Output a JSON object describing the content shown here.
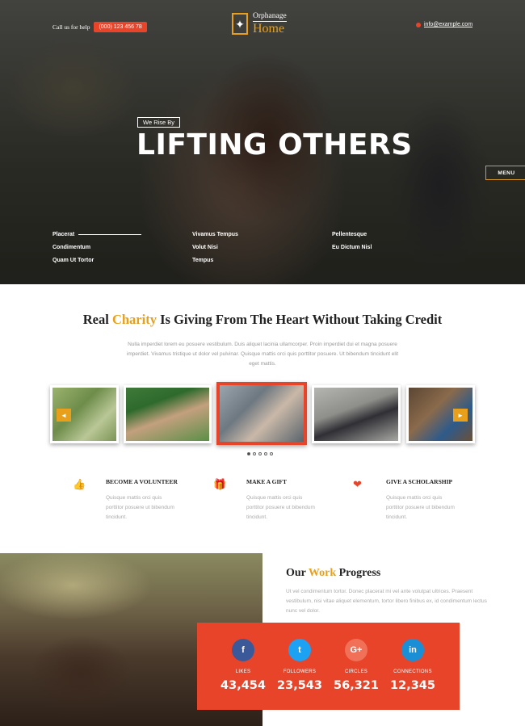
{
  "header": {
    "call_label": "Call us for help",
    "phone": "(000) 123 456 78",
    "logo_top": "Orphanage",
    "logo_bottom": "Home",
    "email": "info@example.com",
    "menu_label": "MENU"
  },
  "hero": {
    "tagline": "We Rise By",
    "title": "LIFTING OTHERS",
    "links_col1": [
      "Placerat",
      "Condimentum",
      "Quam Ut Tortor"
    ],
    "links_col2": [
      "Vivamus Tempus",
      "Volut Nisi",
      "Tempus"
    ],
    "links_col3": [
      "Pellentesque",
      "Eu Dictum Nisl"
    ]
  },
  "charity": {
    "title_pre": "Real ",
    "title_accent": "Charity",
    "title_post": " Is Giving From The Heart Without Taking Credit",
    "description": "Nulla imperdiet lorem eu posuere vestibulum. Duis aliquet lacinia ullamcorper. Proin imperdiet dui et magna posuere imperdiet. Vivamus tristique ut dolor vel pulvinar. Quisque mattis orci quis porttitor posuere. Ut bibendum tincidunt elit eget mattis.",
    "carousel_prev": "◄",
    "carousel_next": "►",
    "dots_active_index": 0
  },
  "features": [
    {
      "icon": "thumbs-up-icon",
      "glyph": "👍",
      "title": "BECOME A VOLUNTEER",
      "text": "Quisque mattis orci quis porttitor posuere ut bibendum tincidunt."
    },
    {
      "icon": "gift-icon",
      "glyph": "🎁",
      "title": "MAKE A GIFT",
      "text": "Quisque mattis orci quis porttitor posuere ut bibendum tincidunt."
    },
    {
      "icon": "heart-icon",
      "glyph": "❤",
      "title": "GIVE A SCHOLARSHIP",
      "text": "Quisque mattis orci quis porttitor posuere ut bibendum tincidunt."
    }
  ],
  "progress": {
    "title_pre": "Our ",
    "title_accent": "Work",
    "title_post": " Progress",
    "description": "Ut vel condimentum tortor. Donec placerat mi vel ante volutpat ultrices. Praesent vestibulum, nisi vitae aliquet elementum, tortor libero finibus ex, id condimentum lectus nunc vel dolor.",
    "stats": [
      {
        "icon": "facebook-icon",
        "glyph": "f",
        "color": "#3b5998",
        "label": "LIKES",
        "value": "43,454"
      },
      {
        "icon": "twitter-icon",
        "glyph": "t",
        "color": "#1da1f2",
        "label": "FOLLOWERS",
        "value": "23,543"
      },
      {
        "icon": "google-plus-icon",
        "glyph": "G+",
        "color": "#f07058",
        "label": "CIRCLES",
        "value": "56,321"
      },
      {
        "icon": "linkedin-icon",
        "glyph": "in",
        "color": "#1a8fd6",
        "label": "CONNECTIONS",
        "value": "12,345"
      }
    ]
  },
  "colors": {
    "accent": "#e8a01c",
    "primary": "#e8442a"
  }
}
